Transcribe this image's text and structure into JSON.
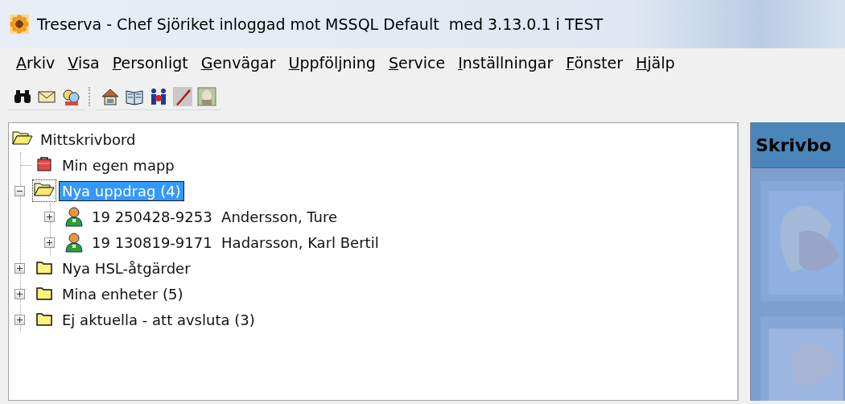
{
  "window": {
    "title": "Treserva - Chef Sjöriket inloggad mot MSSQL Default  med 3.13.0.1 i TEST"
  },
  "menu": [
    "Arkiv",
    "Visa",
    "Personligt",
    "Genvägar",
    "Uppföljning",
    "Service",
    "Inställningar",
    "Fönster",
    "Hjälp"
  ],
  "toolbar": [
    {
      "kind": "binoculars"
    },
    {
      "kind": "envelope"
    },
    {
      "kind": "people"
    },
    {
      "kind": "separator"
    },
    {
      "kind": "house"
    },
    {
      "kind": "book"
    },
    {
      "kind": "figures"
    },
    {
      "kind": "pen"
    },
    {
      "kind": "portrait"
    }
  ],
  "tree": [
    {
      "label": "Mittskrivbord",
      "kind": "openfolder",
      "selected": false,
      "children": [
        {
          "label": "Min egen mapp",
          "kind": "bag",
          "selected": false
        },
        {
          "label": "Nya uppdrag (4)",
          "kind": "openfolder",
          "expanded": true,
          "selected": true,
          "children": [
            {
              "label": "19 250428-9253  Andersson, Ture",
              "kind": "person",
              "expanded": false,
              "selected": false
            },
            {
              "label": "19 130819-9171  Hadarsson, Karl Bertil",
              "kind": "person",
              "expanded": false,
              "selected": false
            }
          ]
        },
        {
          "label": "Nya HSL-åtgärder",
          "kind": "folder",
          "expanded": false,
          "selected": false
        },
        {
          "label": "Mina enheter (5)",
          "kind": "folder",
          "expanded": false,
          "selected": false
        },
        {
          "label": "Ej aktuella - att avsluta (3)",
          "kind": "folder",
          "expanded": false,
          "selected": false
        }
      ]
    }
  ],
  "desk_panel": {
    "title": "Skrivbo"
  }
}
